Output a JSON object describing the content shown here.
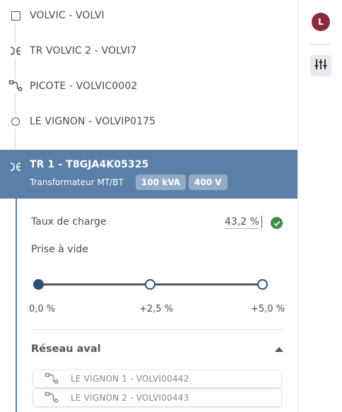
{
  "tree": {
    "items": [
      {
        "label": "VOLVIC - VOLVI",
        "icon": "square-icon"
      },
      {
        "label": "TR VOLVIC 2 - VOLVI7",
        "icon": "transformer-icon"
      },
      {
        "label": "PICOTE - VOLVIC0002",
        "icon": "feeder-icon"
      },
      {
        "label": "LE VIGNON - VOLVIP0175",
        "icon": "circle-icon"
      }
    ]
  },
  "selected": {
    "title": "TR 1 - T8GJA4K05325",
    "subtitle": "Transformateur MT/BT",
    "badges": [
      "100 kVA",
      "400 V"
    ],
    "color": "#5a7fa8"
  },
  "detail": {
    "charge_label": "Taux de charge",
    "charge_value": "43,2 %",
    "prise_label": "Prise à vide",
    "slider": {
      "ticks": [
        "0,0 %",
        "+2,5 %",
        "+5,0 %"
      ],
      "selected_index": 0
    },
    "reseau_title": "Réseau aval",
    "reseau_items": [
      {
        "label": "LE VIGNON 1 - VOLVI00442"
      },
      {
        "label": "LE VIGNON 2 - VOLVI00443"
      }
    ]
  },
  "rail": {
    "avatar_letter": "L",
    "avatar_color": "#8b2a3d"
  }
}
